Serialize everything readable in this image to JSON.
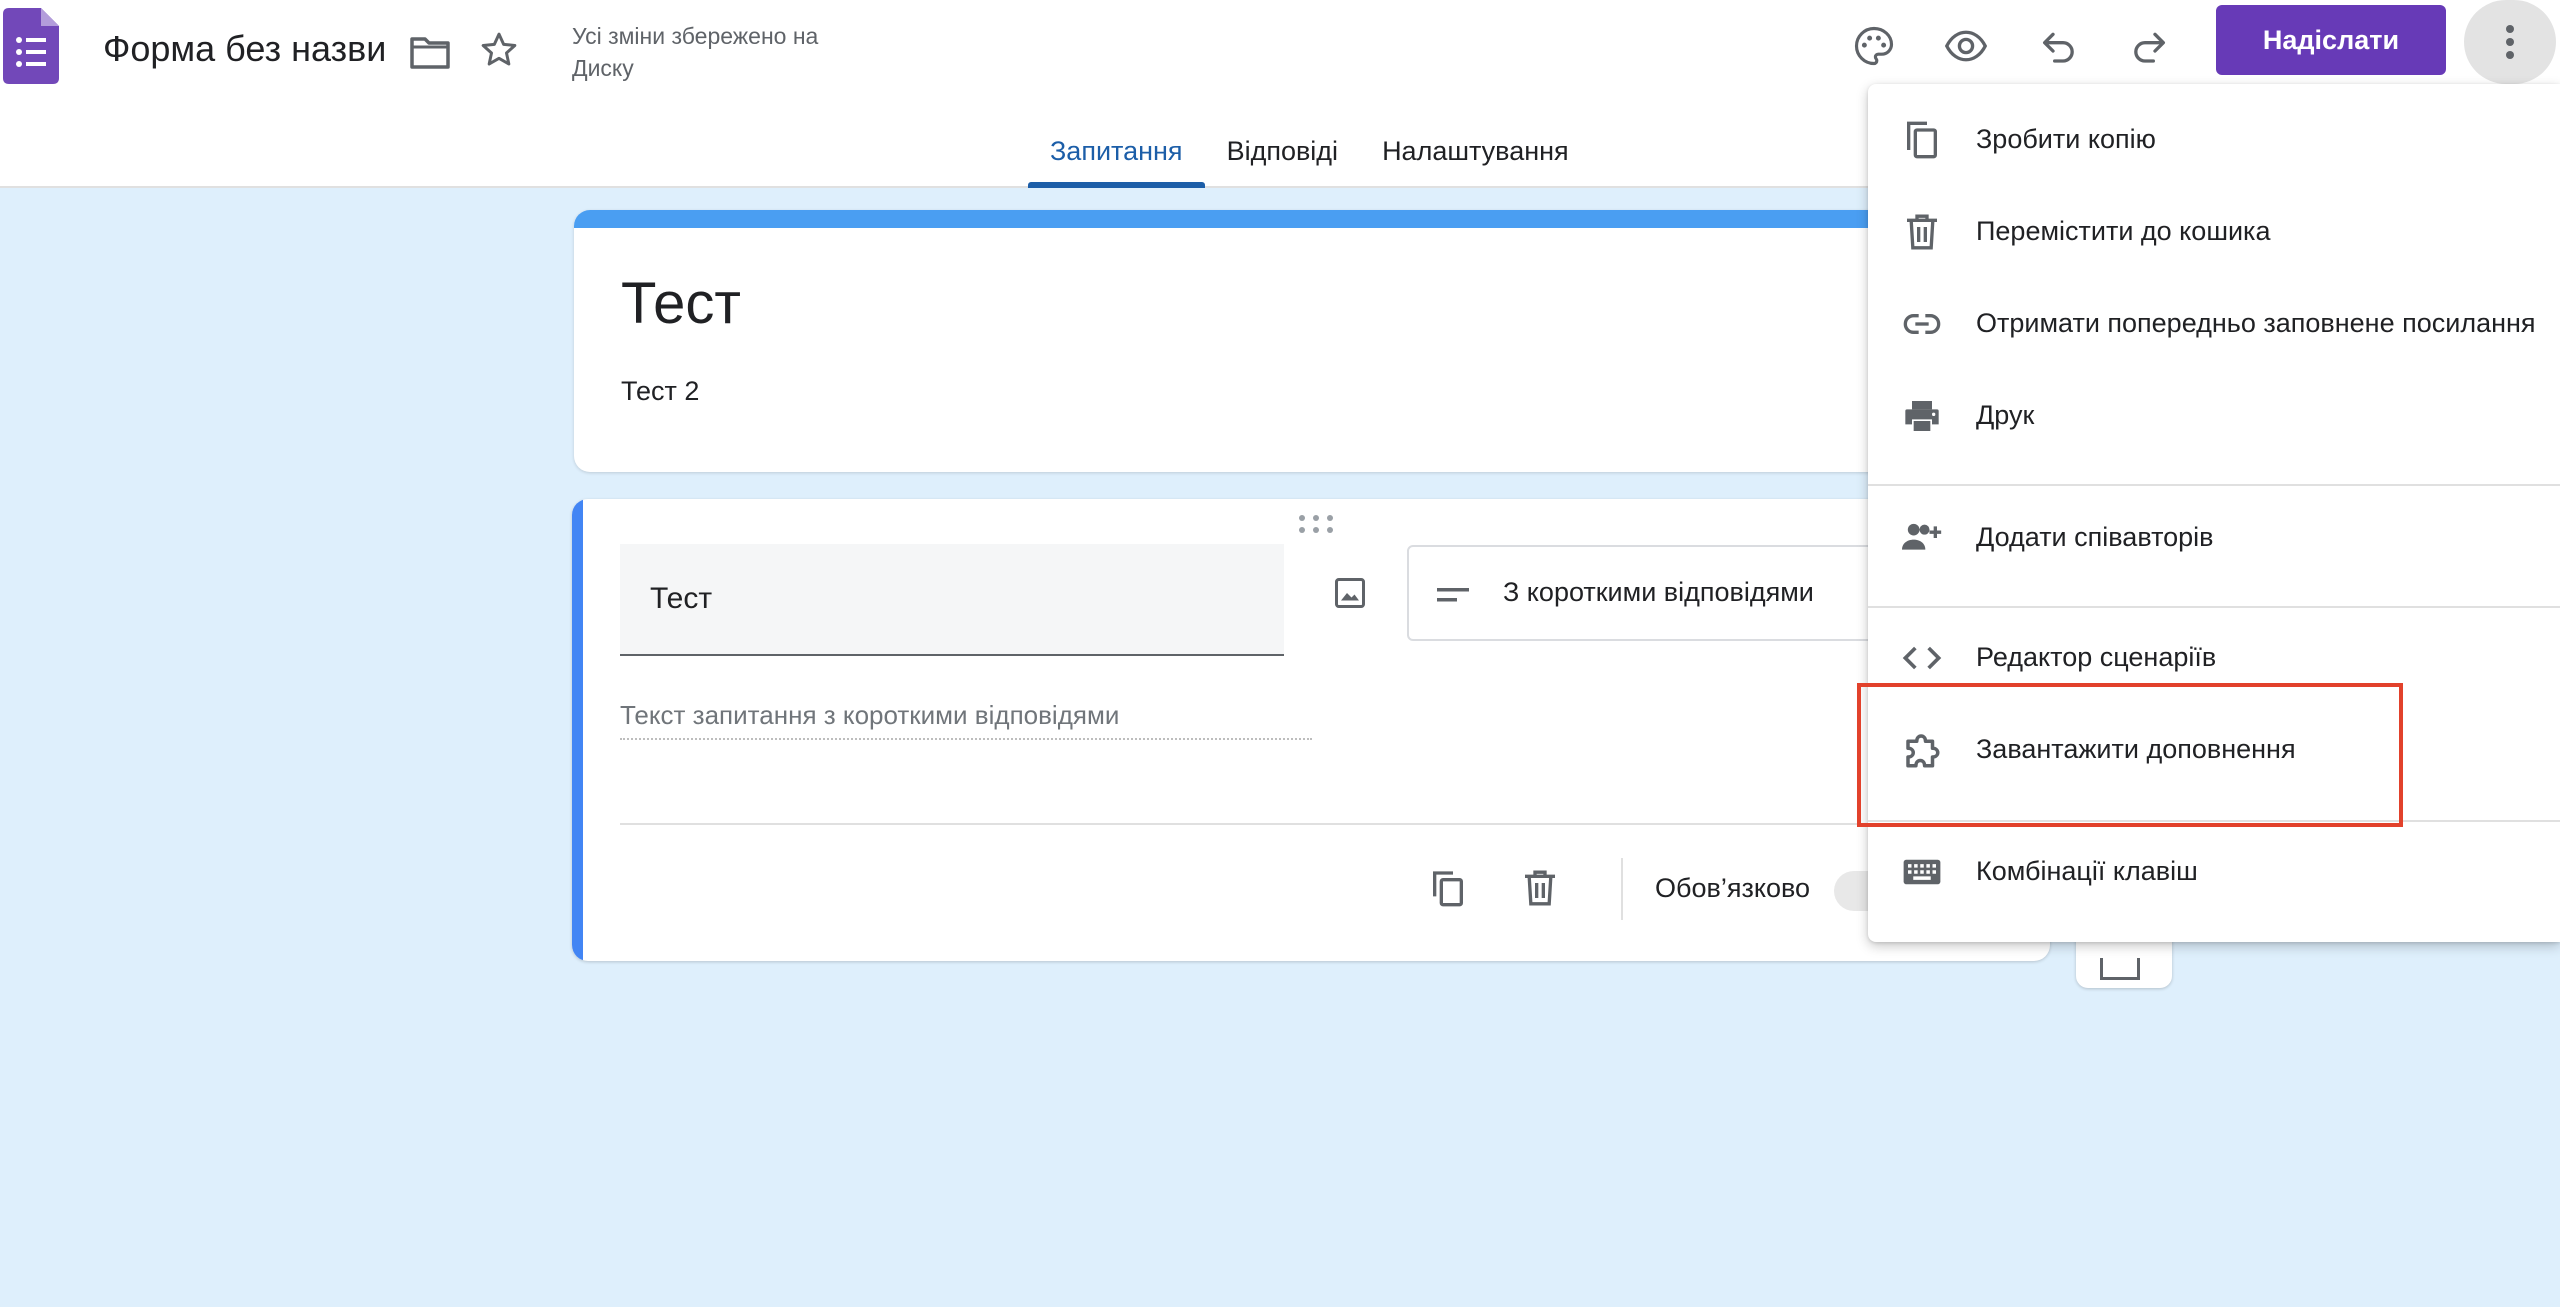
{
  "header": {
    "doc_title": "Форма без назви",
    "save_status": "Усі зміни збережено на Диску",
    "send_label": "Надіслати",
    "colors": {
      "brand": "#673ab7",
      "tab_accent": "#1c5ea8"
    },
    "icons": [
      "forms-logo-icon",
      "folder-icon",
      "star-icon",
      "palette-icon",
      "eye-icon",
      "undo-icon",
      "redo-icon",
      "more-vert-icon"
    ]
  },
  "tabs": [
    {
      "label": "Запитання",
      "active": true
    },
    {
      "label": "Відповіді",
      "active": false
    },
    {
      "label": "Налаштування",
      "active": false
    }
  ],
  "form": {
    "title": "Тест",
    "description": "Тест 2"
  },
  "question": {
    "title": "Тест",
    "type_label": "З короткими відповідями",
    "answer_placeholder": "Текст запитання з короткими відповідями",
    "required_label": "Обов’язково"
  },
  "menu": {
    "items": [
      {
        "label": "Зробити копію",
        "icon": "copy-icon"
      },
      {
        "label": "Перемістити до кошика",
        "icon": "trash-icon"
      },
      {
        "label": "Отримати попередньо заповнене посилання",
        "icon": "link-icon"
      },
      {
        "label": "Друк",
        "icon": "print-icon"
      },
      {
        "label": "Додати співавторів",
        "icon": "add-people-icon"
      },
      {
        "label": "Редактор сценаріїв",
        "icon": "code-icon"
      },
      {
        "label": "Завантажити доповнення",
        "icon": "puzzle-icon"
      },
      {
        "label": "Комбінації клавіш",
        "icon": "keyboard-icon"
      }
    ],
    "highlight_color": "#e2412b"
  }
}
